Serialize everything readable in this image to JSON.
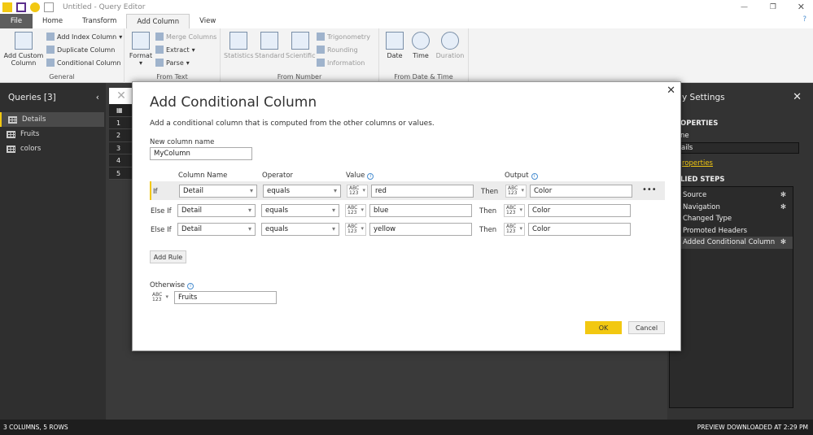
{
  "window": {
    "title": "Untitled - Query Editor"
  },
  "tabs": [
    "File",
    "Home",
    "Transform",
    "Add Column",
    "View"
  ],
  "ribbon": {
    "general": {
      "label": "General",
      "add_custom": "Add Custom Column",
      "add_index": "Add Index Column",
      "duplicate": "Duplicate Column",
      "conditional": "Conditional Column"
    },
    "text": {
      "label": "From Text",
      "format": "Format",
      "merge": "Merge Columns",
      "extract": "Extract",
      "parse": "Parse"
    },
    "number": {
      "label": "From Number",
      "statistics": "Statistics",
      "standard": "Standard",
      "scientific": "Scientific",
      "trig": "Trigonometry",
      "rounding": "Rounding",
      "information": "Information"
    },
    "datetime": {
      "label": "From Date & Time",
      "date": "Date",
      "time": "Time",
      "duration": "Duration"
    }
  },
  "queries": {
    "title": "Queries [3]",
    "items": [
      "Details",
      "Fruits",
      "colors"
    ]
  },
  "grid": {
    "rows": [
      "1",
      "2",
      "3",
      "4",
      "5"
    ]
  },
  "settings": {
    "title": "y Settings",
    "properties": "OPERTIES",
    "name_label": "ne",
    "name_value": "ails",
    "all_properties": "roperties",
    "applied_steps": "LIED STEPS",
    "steps": [
      "Source",
      "Navigation",
      "Changed Type",
      "Promoted Headers",
      "Added Conditional Column"
    ]
  },
  "status": {
    "left": "3 COLUMNS, 5 ROWS",
    "right": "PREVIEW DOWNLOADED AT 2:29 PM"
  },
  "dialog": {
    "title": "Add Conditional Column",
    "description": "Add a conditional column that is computed from the other columns or values.",
    "new_col_label": "New column name",
    "new_col_value": "MyColumn",
    "headers": {
      "column": "Column Name",
      "operator": "Operator",
      "value": "Value",
      "output": "Output"
    },
    "type_label": "ABC 123",
    "rules": [
      {
        "kw": "If",
        "column": "Detail",
        "operator": "equals",
        "value": "red",
        "then": "Then",
        "output": "Color"
      },
      {
        "kw": "Else If",
        "column": "Detail",
        "operator": "equals",
        "value": "blue",
        "then": "Then",
        "output": "Color"
      },
      {
        "kw": "Else If",
        "column": "Detail",
        "operator": "equals",
        "value": "yellow",
        "then": "Then",
        "output": "Color"
      }
    ],
    "more": "•••",
    "add_rule": "Add Rule",
    "otherwise_label": "Otherwise",
    "otherwise_value": "Fruits",
    "ok": "OK",
    "cancel": "Cancel"
  },
  "colors": {
    "accent": "#f2c811"
  }
}
